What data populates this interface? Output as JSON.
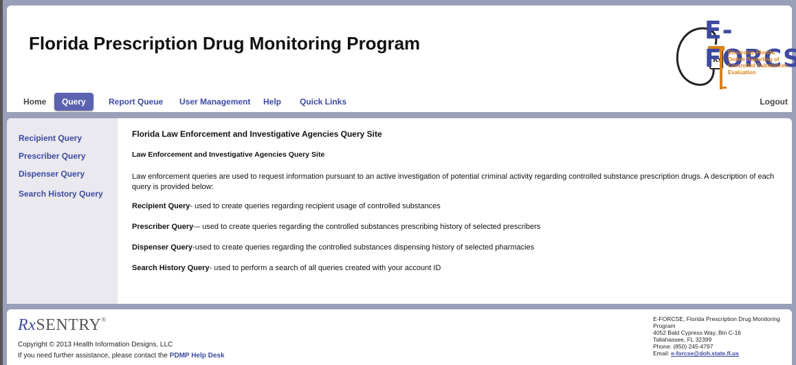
{
  "header": {
    "title": "Florida Prescription Drug Monitoring Program",
    "logo_main": "E-FORCSE",
    "logo_lines": [
      "Electronic-Florida",
      "Online Reporting of",
      "Controlled Substances",
      "Evaluation"
    ],
    "logo_rx": "Rx"
  },
  "nav": {
    "items": [
      {
        "label": "Home"
      },
      {
        "label": "Query"
      },
      {
        "label": "Report Queue"
      },
      {
        "label": "User Management"
      },
      {
        "label": "Help"
      },
      {
        "label": "Quick Links"
      }
    ],
    "active": "Query",
    "logout": "Logout"
  },
  "sidebar": {
    "items": [
      {
        "label": "Recipient Query"
      },
      {
        "label": "Prescriber Query"
      },
      {
        "label": "Dispenser Query"
      },
      {
        "label": "Search History Query"
      }
    ]
  },
  "main": {
    "heading": "Florida Law Enforcement and Investigative Agencies Query Site",
    "subheading": "Law Enforcement and Investigative Agencies Query Site",
    "description": "Law enforcement queries are used to request information pursuant to an active investigation of potential criminal activity regarding controlled substance prescription drugs. A description of each query is provided below:",
    "queries": [
      {
        "name": "Recipient Query",
        "text": "- used to create queries regarding recipient usage of controlled substances"
      },
      {
        "name": "Prescriber Query",
        "text": "-– used to create queries regarding the controlled substances prescribing history of selected prescribers"
      },
      {
        "name": "Dispenser Query",
        "text": "-used to create queries regarding the controlled substances dispensing history of selected pharmacies"
      },
      {
        "name": "Search History Query",
        "text": "- used to perform a search of all queries created with your account ID"
      }
    ]
  },
  "footer": {
    "brand_rx": "Rx",
    "brand_name": "SENTRY",
    "brand_tm": "®",
    "copyright": "Copyright © 2013 Health Information Designs, LLC",
    "assist_text": "If you need further assistance, please contact the ",
    "assist_link": "PDMP Help Desk",
    "contact": {
      "org": "E-FORCSE, Florida Prescription Drug Monitoring Program",
      "address1": "4052 Bald Cypress Way, Bin C-16",
      "address2": "Tallahassee, FL 32399",
      "phone": "Phone: (850) 245-4797",
      "email_label": "Email: ",
      "email": "e-forcse@doh.state.fl.us"
    }
  },
  "colors": {
    "accent": "#3d4aa0",
    "nav_active_bg": "#5b63b0",
    "page_bg": "#9aa0b8",
    "sidebar_bg": "#e9e9ef",
    "logo_orange": "#d9821c"
  }
}
